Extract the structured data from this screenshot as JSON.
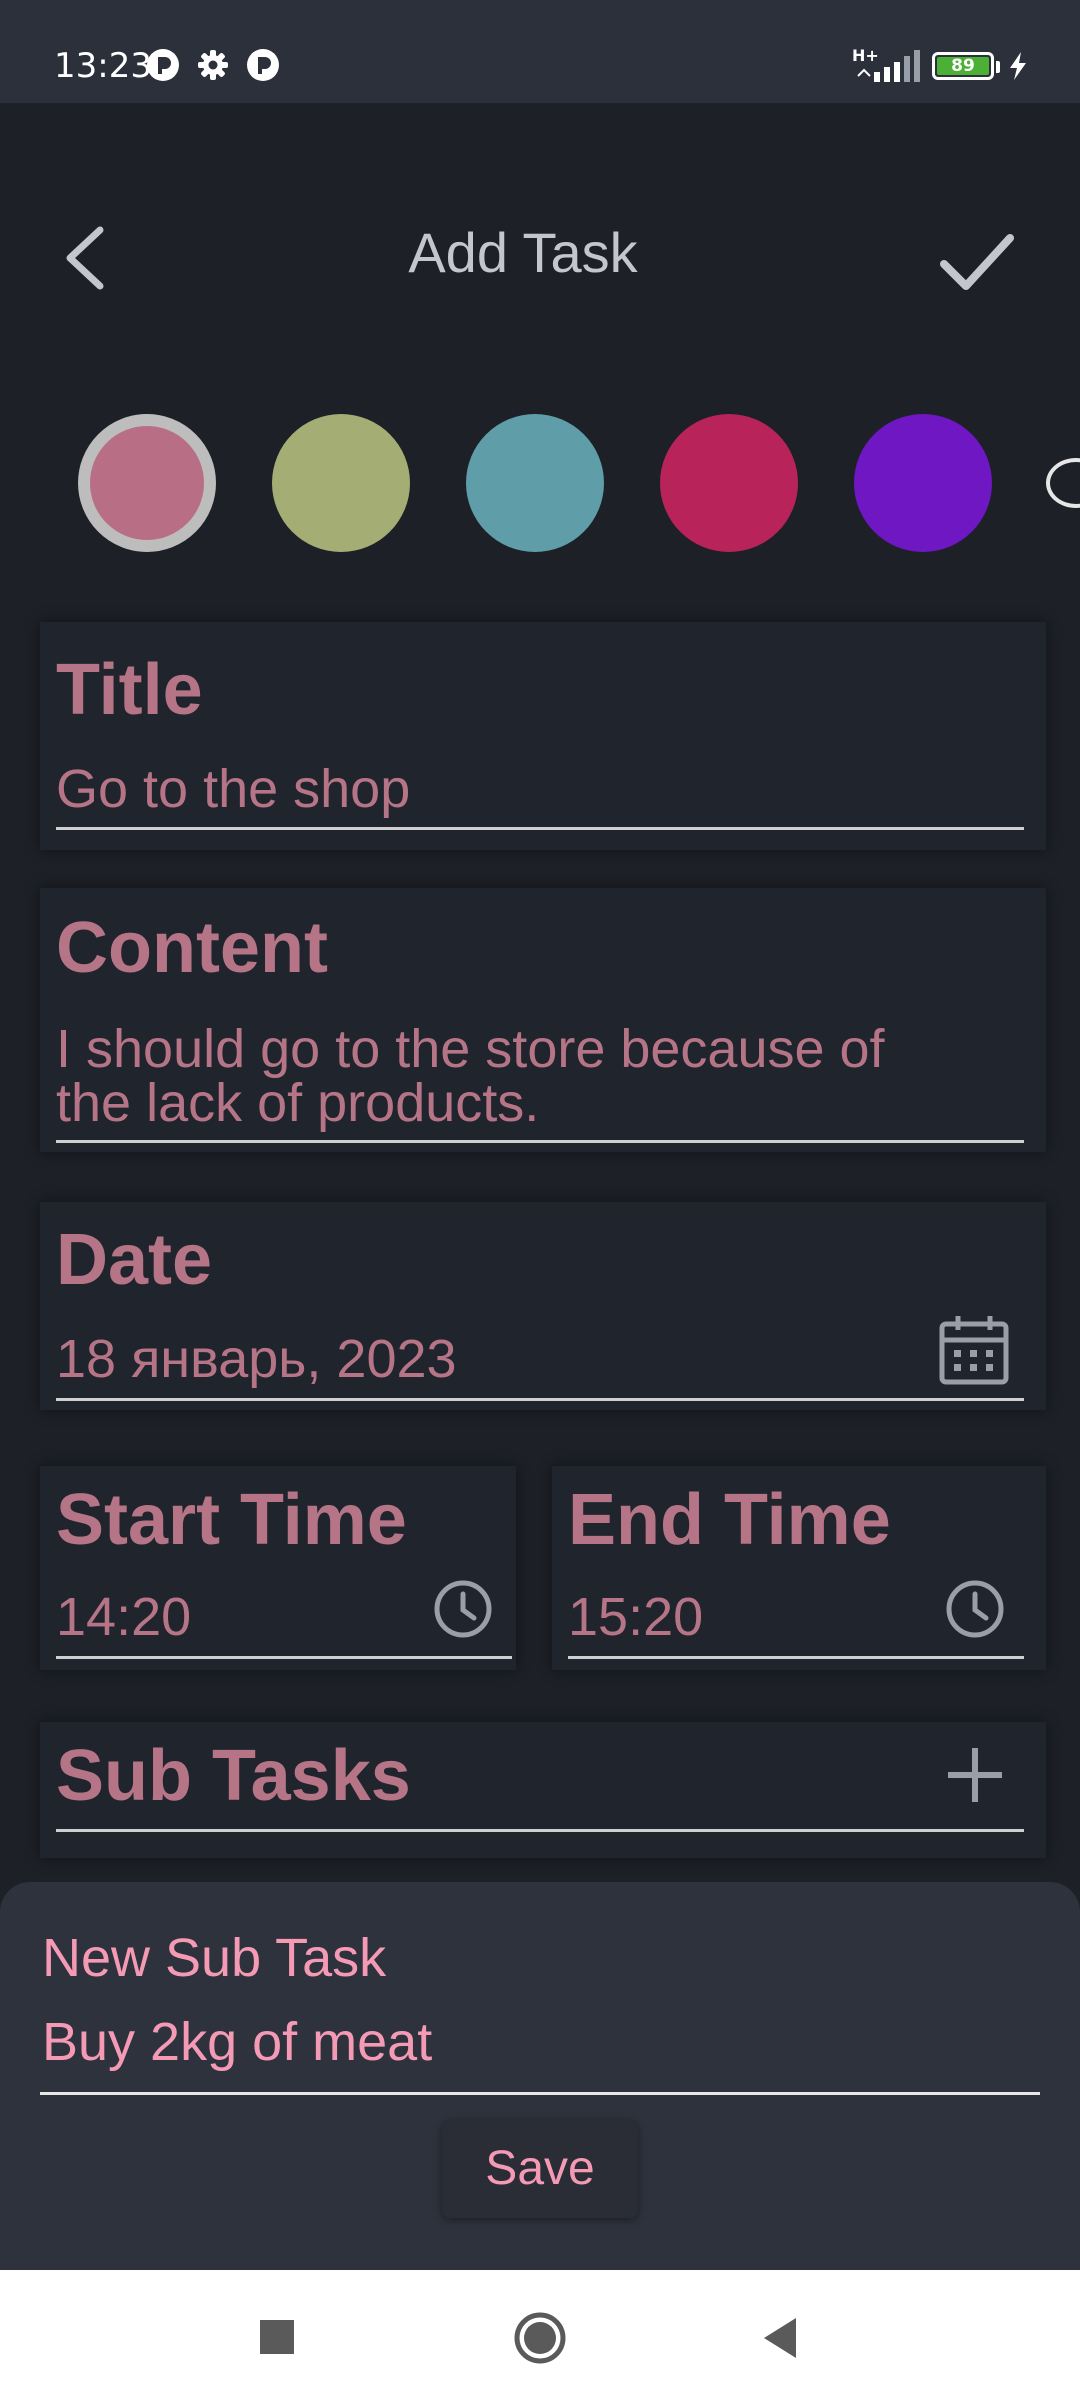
{
  "status_bar": {
    "time": "13:23",
    "network": "H+",
    "battery": "89",
    "icons": [
      "p-icon",
      "gear-icon",
      "p-icon",
      "signal-icon",
      "battery-icon",
      "charging-icon"
    ]
  },
  "header": {
    "title": "Add Task",
    "back_icon": "chevron-left-icon",
    "confirm_icon": "checkmark-icon"
  },
  "colors": {
    "options": [
      "#b86f86",
      "#a3ad74",
      "#5f9ea9",
      "#b8235a",
      "#6e17c2"
    ],
    "selected_index": 0
  },
  "form": {
    "title": {
      "label": "Title",
      "value": "Go to the shop"
    },
    "content": {
      "label": "Content",
      "value_line1": "I should go to the store because of",
      "value_line2": "the lack of products."
    },
    "date": {
      "label": "Date",
      "value": "18 январь, 2023",
      "icon": "calendar-icon"
    },
    "start_time": {
      "label": "Start Time",
      "value": "14:20",
      "icon": "clock-icon"
    },
    "end_time": {
      "label": "End Time",
      "value": "15:20",
      "icon": "clock-icon"
    },
    "sub_tasks": {
      "label": "Sub Tasks",
      "icon": "plus-icon"
    }
  },
  "sheet": {
    "label": "New Sub Task",
    "input_value": "Buy 2kg of meat",
    "save_label": "Save"
  },
  "nav": {
    "icons": [
      "recents-square-icon",
      "home-circle-icon",
      "back-triangle-icon"
    ]
  },
  "theme": {
    "accent": "#b67587",
    "sheet_accent": "#f49ab5",
    "background": "#1d2027"
  }
}
